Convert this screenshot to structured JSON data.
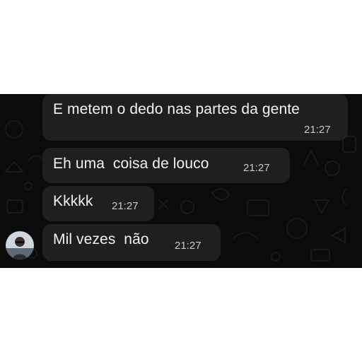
{
  "chat": {
    "messages": [
      {
        "text": "E metem o dedo nas partes da gente",
        "time": "21:27"
      },
      {
        "text": "Eh uma  coisa de louco",
        "time": "21:27"
      },
      {
        "text": "Kkkkk",
        "time": "21:27"
      },
      {
        "text": "Mil vezes  não",
        "time": "21:27"
      }
    ]
  },
  "colors": {
    "background": "#0b0b0b",
    "bubble": "#1f1f1f",
    "text": "#f2f2f2",
    "timestamp": "#c9c9c9",
    "page": "#ffffff"
  },
  "icons": [
    "doodle-wallpaper",
    "sender-avatar-icon"
  ]
}
